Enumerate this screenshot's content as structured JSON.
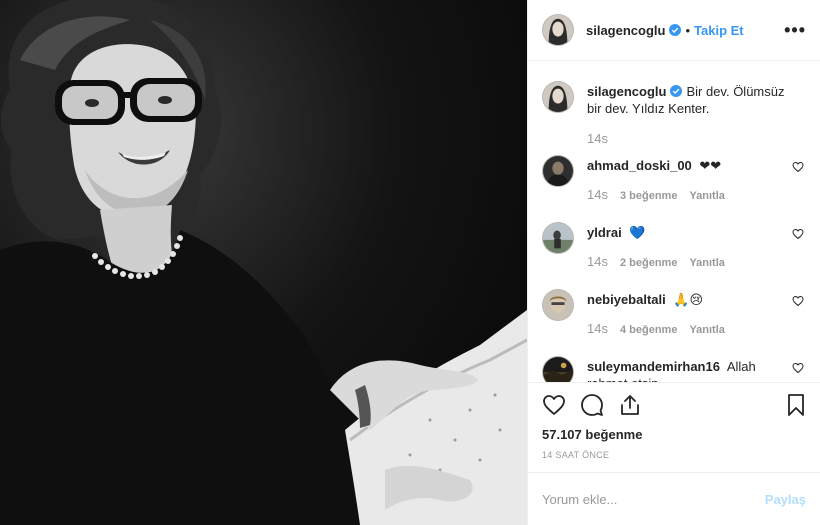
{
  "post": {
    "author": "silagencoglu",
    "verified": true,
    "follow_label": "Takip Et",
    "separator": "•",
    "more_label": "•••",
    "caption_text": "Bir dev. Ölümsüz bir dev. Yıldız Kenter.",
    "caption_time": "14s"
  },
  "comments": [
    {
      "user": "ahmad_doski_00",
      "text": "❤❤",
      "time": "14s",
      "likes": "3 beğenme",
      "reply": "Yanıtla"
    },
    {
      "user": "yldrai",
      "text": "💙",
      "time": "14s",
      "likes": "2 beğenme",
      "reply": "Yanıtla"
    },
    {
      "user": "nebiyebaltali",
      "text": "🙏😢",
      "time": "14s",
      "likes": "4 beğenme",
      "reply": "Yanıtla"
    },
    {
      "user": "suleymandemirhan16",
      "text": "Allah rahmet etsin.",
      "time": "",
      "likes": "",
      "reply": ""
    }
  ],
  "footer": {
    "likes_count": "57.107 beğenme",
    "time_ago": "14 SAAT ÖNCE",
    "comment_placeholder": "Yorum ekle...",
    "share_label": "Paylaş"
  },
  "colors": {
    "accent": "#3897f0",
    "share_disabled": "#b2dffc",
    "muted": "#999999"
  }
}
